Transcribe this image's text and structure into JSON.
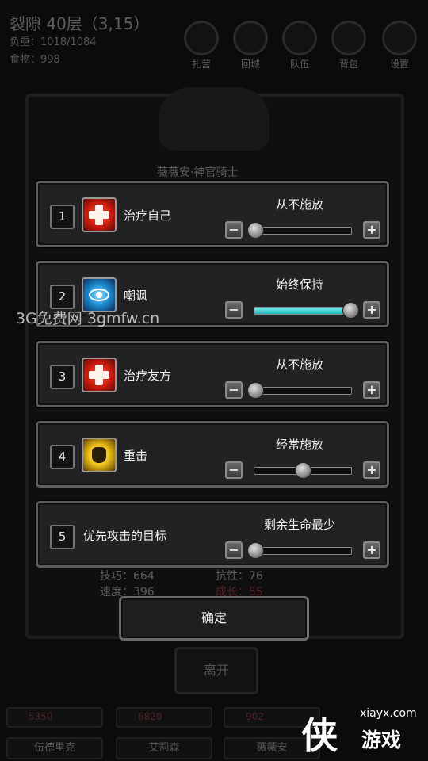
{
  "hud": {
    "title": "裂隙 40层（3,15）",
    "load": "负重：1018/1084",
    "food": "食物：998",
    "buttons": [
      "扎营",
      "回城",
      "队伍",
      "背包",
      "设置"
    ]
  },
  "character": {
    "name": "薇薇安·神官骑士",
    "stats": [
      {
        "text": "技巧：664"
      },
      {
        "text": "抗性：76"
      },
      {
        "text": "速度：396"
      },
      {
        "text": "成长：55"
      }
    ]
  },
  "leave_label": "离开",
  "party": [
    {
      "hp": "5350",
      "name": "伍德里克"
    },
    {
      "hp": "6820",
      "name": "艾莉森"
    },
    {
      "hp": "902",
      "name": "薇薇安"
    }
  ],
  "skills": [
    {
      "index": "1",
      "icon": "heal-icon",
      "label": "治疗自己",
      "state": "从不施放",
      "level": 0.0
    },
    {
      "index": "2",
      "icon": "taunt-eye-icon",
      "label": "嘲讽",
      "state": "始终保持",
      "level": 1.0
    },
    {
      "index": "3",
      "icon": "heal-icon",
      "label": "治疗友方",
      "state": "从不施放",
      "level": 0.0
    },
    {
      "index": "4",
      "icon": "fist-icon",
      "label": "重击",
      "state": "经常施放",
      "level": 0.5
    },
    {
      "index": "5",
      "icon": "",
      "label": "优先攻击的目标",
      "state": "剩余生命最少",
      "level": 0.0
    }
  ],
  "controls": {
    "minus": "−",
    "plus": "+"
  },
  "confirm_label": "确定",
  "watermark": "3G免费网  3gmfw.cn",
  "logo": {
    "glyph": "侠",
    "url": "xiayx.com",
    "brand": "游戏"
  },
  "colors": {
    "accent": "#1fb3b8",
    "panel": "#222224",
    "heal": "#c81b0e",
    "taunt": "#1e8fd4",
    "strike": "#f0c21a"
  }
}
